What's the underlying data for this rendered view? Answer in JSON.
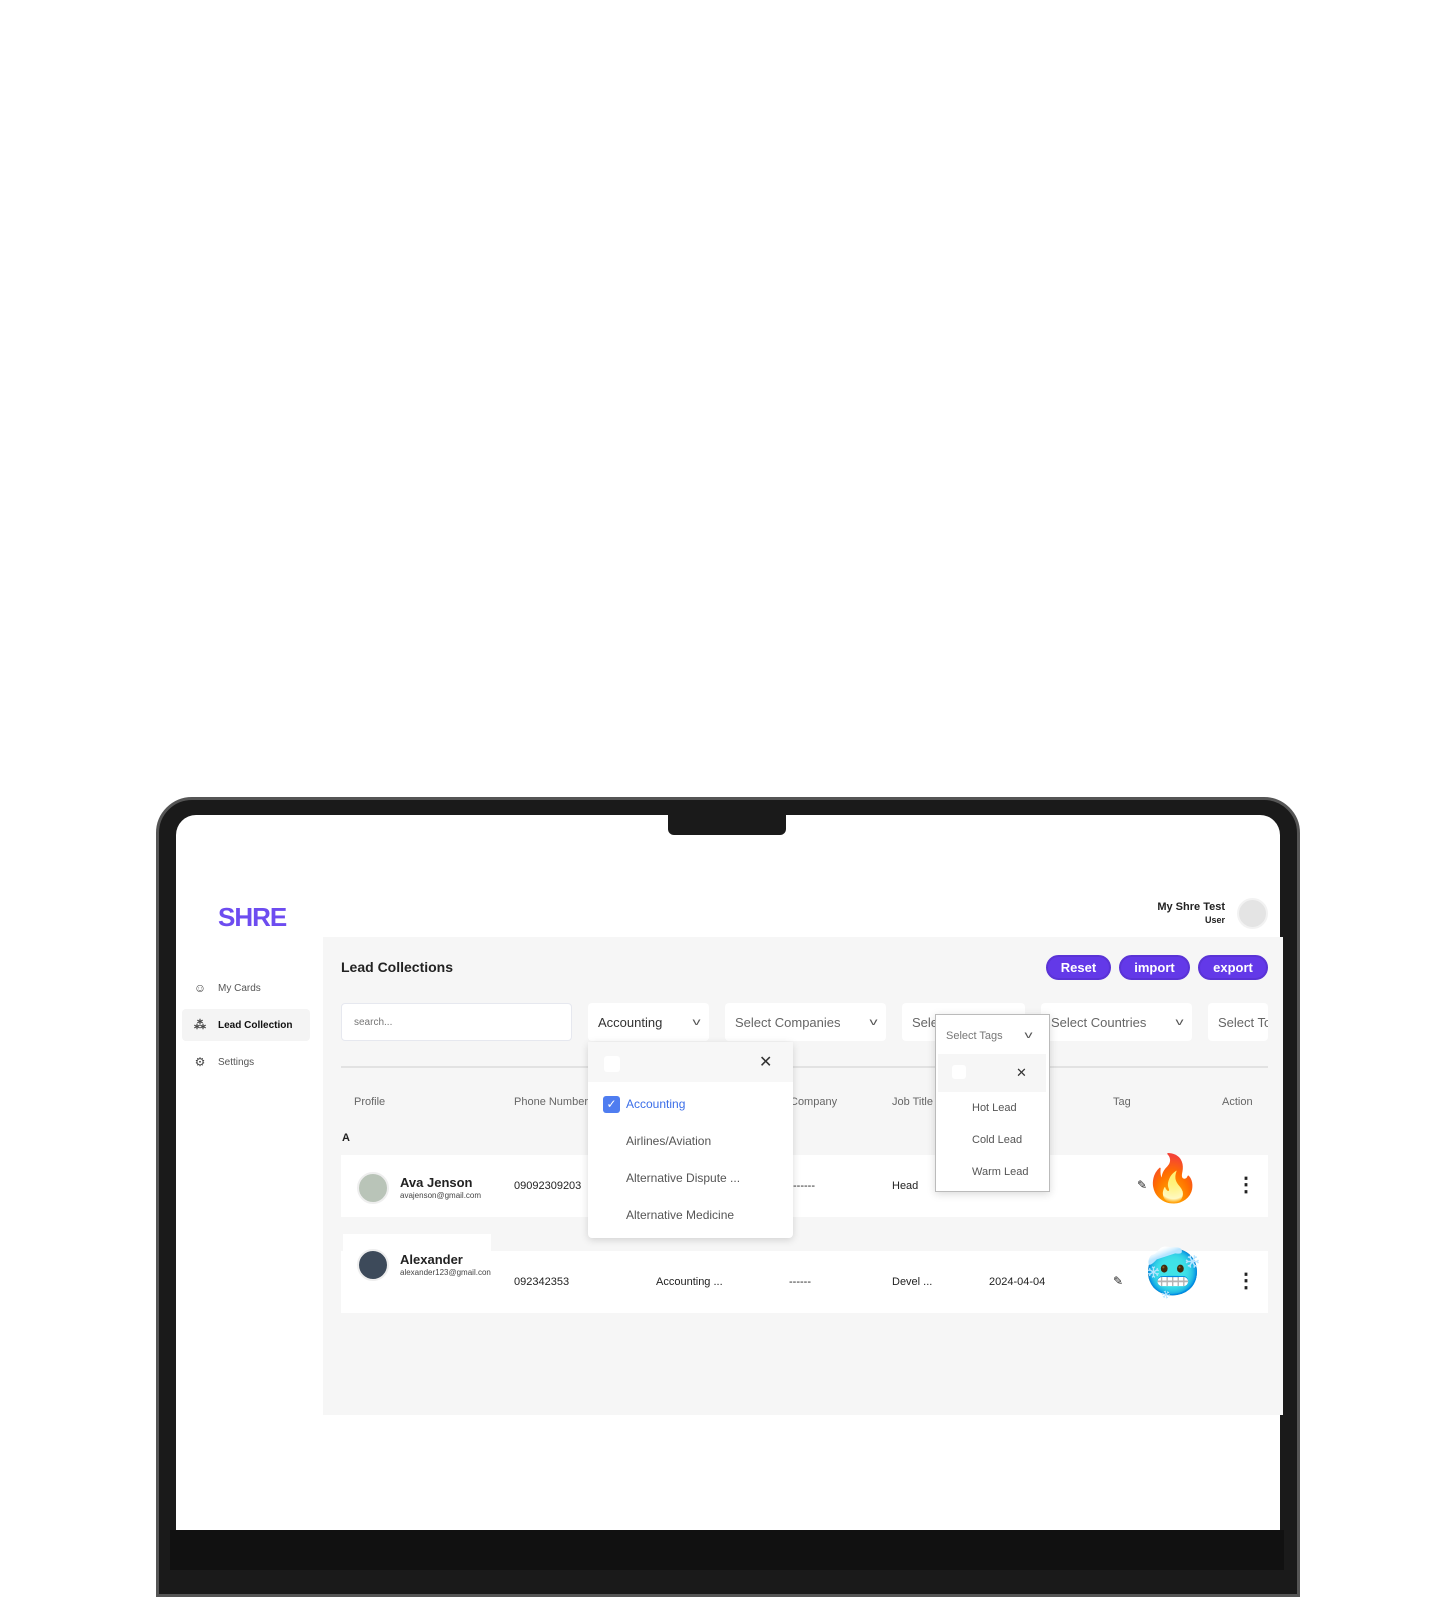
{
  "brand": {
    "logo": "SHRE",
    "accent": "#6d4cf0"
  },
  "user": {
    "name": "My Shre Test",
    "role": "User"
  },
  "sidebar": {
    "items": [
      {
        "label": "My Cards",
        "icon": "user-icon"
      },
      {
        "label": "Lead Collection",
        "icon": "people-icon",
        "active": true
      },
      {
        "label": "Settings",
        "icon": "gear-icon"
      }
    ]
  },
  "page": {
    "title": "Lead Collections"
  },
  "toolbar": {
    "reset": "Reset",
    "import": "import",
    "export": "export"
  },
  "filters": {
    "search_placeholder": "search...",
    "industry": "Accounting",
    "companies": "Select Companies",
    "tags_partial": "Sele",
    "countries": "Select Countries",
    "last_partial": "Select To"
  },
  "industry_dropdown": {
    "options": [
      {
        "label": "Accounting",
        "checked": true
      },
      {
        "label": "Airlines/Aviation"
      },
      {
        "label": "Alternative Dispute ..."
      },
      {
        "label": "Alternative Medicine"
      }
    ]
  },
  "tags_dropdown": {
    "placeholder": "Select Tags",
    "options": [
      "Hot Lead",
      "Cold Lead",
      "Warm Lead"
    ]
  },
  "table": {
    "headers": [
      "Profile",
      "Phone Number",
      "Company",
      "Job Title",
      "Tag",
      "Action"
    ],
    "group": "A",
    "rows": [
      {
        "name": "Ava Jenson",
        "email": "avajenson@gmail.com",
        "phone": "09092309203",
        "industry": "",
        "company": "------",
        "job": "Head",
        "date": "",
        "tag": "hot",
        "tag_emoji": "🔥"
      },
      {
        "name": "Alexander",
        "email": "alexander123@gmail.con",
        "phone": "092342353",
        "industry": "Accounting ...",
        "company": "------",
        "job": "Devel ...",
        "date": "2024-04-04",
        "tag": "cold",
        "tag_emoji": "🥶"
      }
    ]
  }
}
